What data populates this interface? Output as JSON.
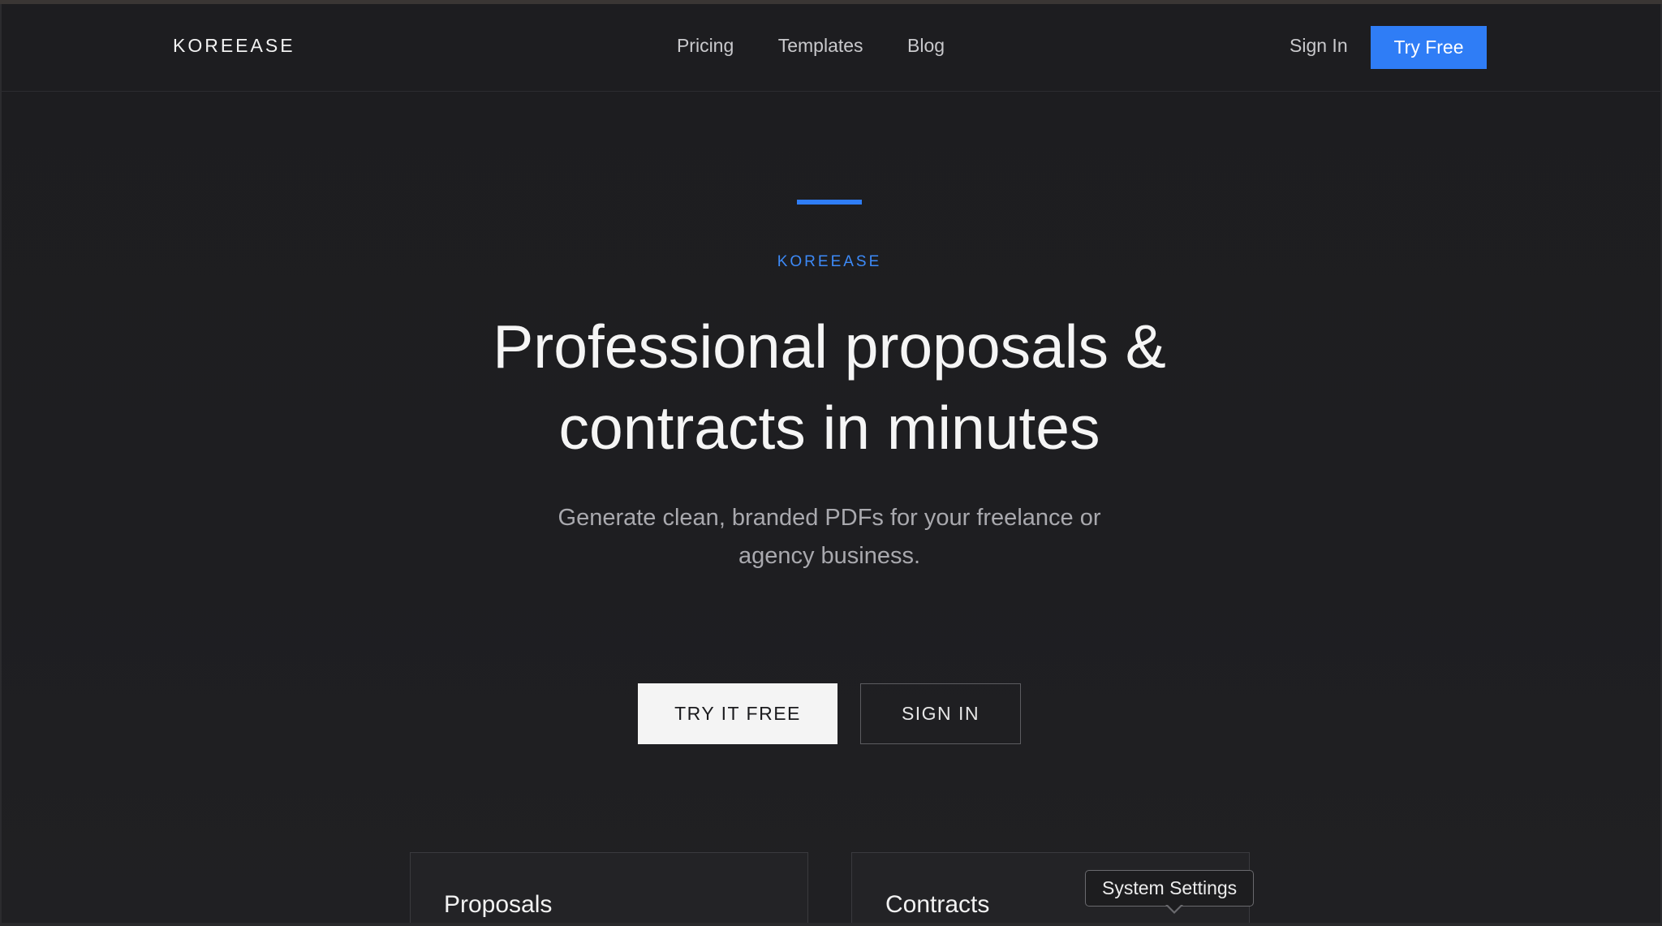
{
  "navbar": {
    "brand": "KOREEASE",
    "links": [
      "Pricing",
      "Templates",
      "Blog"
    ],
    "sign_in": "Sign In",
    "try_free": "Try Free"
  },
  "hero": {
    "eyebrow": "KOREEASE",
    "title_line1": "Professional proposals &",
    "title_line2": "contracts in minutes",
    "subtitle_line1": "Generate clean, branded PDFs for your freelance or",
    "subtitle_line2": "agency business.",
    "cta_primary": "TRY IT FREE",
    "cta_secondary": "SIGN IN"
  },
  "cards": [
    {
      "title": "Proposals"
    },
    {
      "title": "Contracts"
    }
  ],
  "tooltip": {
    "text": "System Settings"
  },
  "colors": {
    "background": "#1d1d20",
    "accent": "#2f7df6",
    "text_primary": "#f5f5f5",
    "text_muted": "#a9a9ae"
  }
}
